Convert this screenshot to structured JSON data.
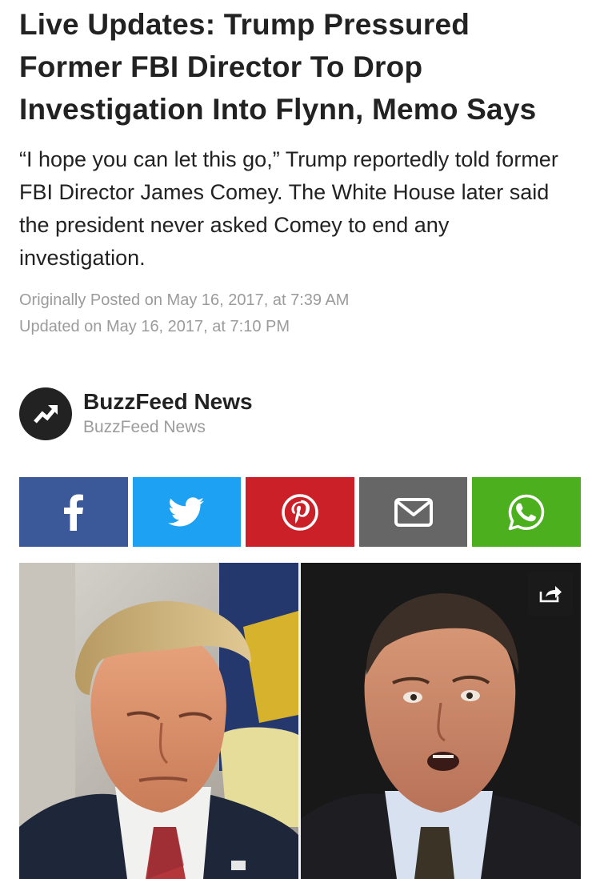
{
  "article": {
    "headline": "Live Updates: Trump Pressured Former FBI Director To Drop Investigation Into Flynn, Memo Says",
    "dek": "“I hope you can let this go,” Trump reportedly told former FBI Director James Comey. The White House later said the president never asked Comey to end any investigation.",
    "originally_posted": "Originally Posted on May 16, 2017, at 7:39 AM",
    "updated": "Updated on May 16, 2017, at 7:10 PM"
  },
  "byline": {
    "author_name": "BuzzFeed News",
    "author_subtitle": "BuzzFeed News",
    "avatar_icon": "trending-arrow-icon"
  },
  "share_buttons": [
    {
      "network": "facebook",
      "icon": "facebook-icon",
      "color": "#3b5998"
    },
    {
      "network": "twitter",
      "icon": "twitter-icon",
      "color": "#1da1f2"
    },
    {
      "network": "pinterest",
      "icon": "pinterest-icon",
      "color": "#cb2027"
    },
    {
      "network": "email",
      "icon": "email-icon",
      "color": "#666666"
    },
    {
      "network": "whatsapp",
      "icon": "whatsapp-icon",
      "color": "#4caf1e"
    }
  ],
  "hero_image": {
    "share_icon": "share-arrow-icon"
  }
}
